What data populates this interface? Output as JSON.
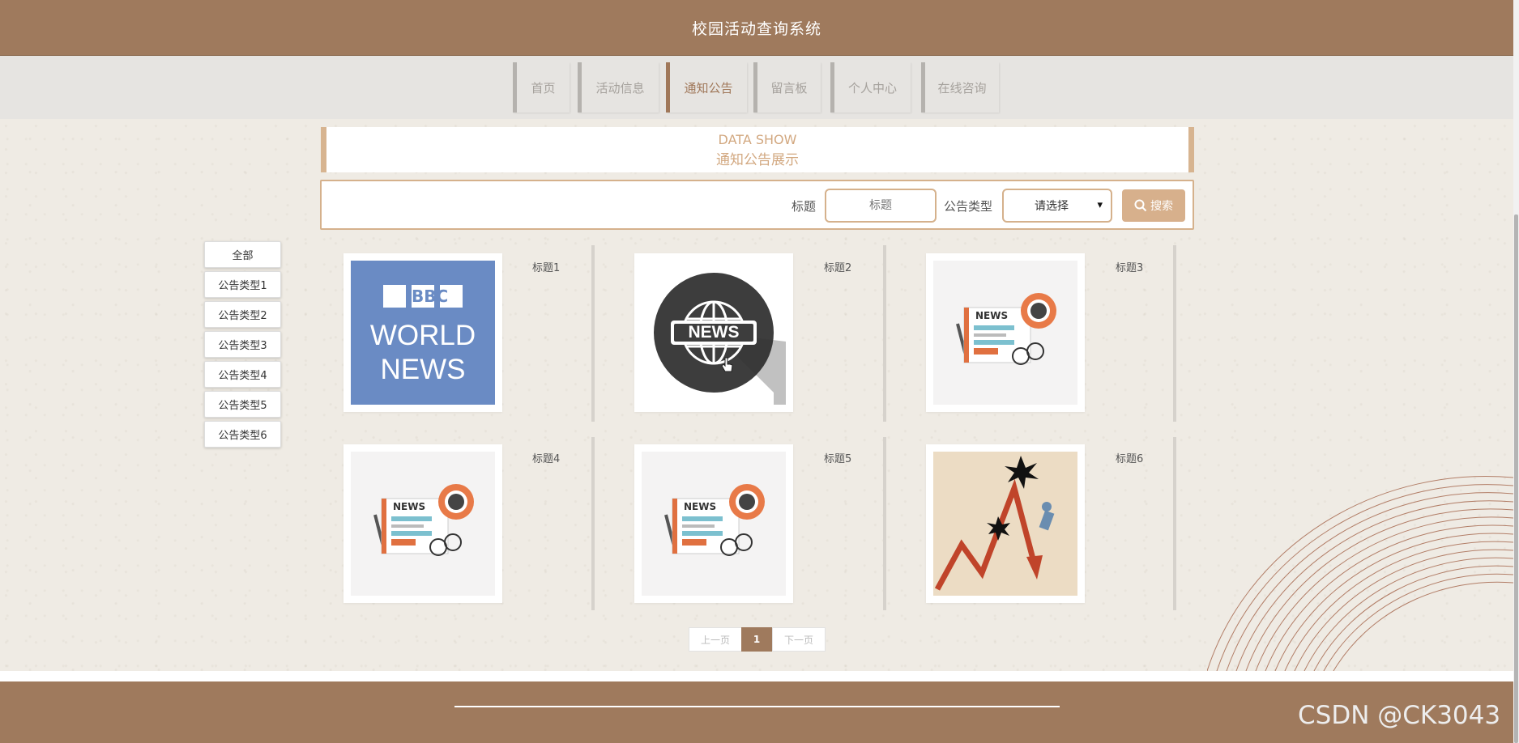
{
  "header": {
    "title": "校园活动查询系统"
  },
  "nav": {
    "items": [
      {
        "label": "首页",
        "active": false
      },
      {
        "label": "活动信息",
        "active": false
      },
      {
        "label": "通知公告",
        "active": true
      },
      {
        "label": "留言板",
        "active": false
      },
      {
        "label": "个人中心",
        "active": false
      },
      {
        "label": "在线咨询",
        "active": false
      }
    ]
  },
  "section": {
    "title_en": "DATA SHOW",
    "title_cn": "通知公告展示"
  },
  "search": {
    "title_label": "标题",
    "title_placeholder": "标题",
    "type_label": "公告类型",
    "type_selected": "请选择",
    "button_label": "搜索"
  },
  "sidebar": {
    "categories": [
      "全部",
      "公告类型1",
      "公告类型2",
      "公告类型3",
      "公告类型4",
      "公告类型5",
      "公告类型6"
    ]
  },
  "cards": [
    {
      "title": "标题1",
      "image": "bbc-world-news"
    },
    {
      "title": "标题2",
      "image": "news-globe-badge"
    },
    {
      "title": "标题3",
      "image": "newspaper-coffee-glasses"
    },
    {
      "title": "标题4",
      "image": "newspaper-coffee-glasses"
    },
    {
      "title": "标题5",
      "image": "newspaper-coffee-glasses"
    },
    {
      "title": "标题6",
      "image": "falling-stock-chart"
    }
  ],
  "bbc_image_text": {
    "line1": "BBC",
    "line2": "WORLD",
    "line3": "NEWS"
  },
  "news_badge_text": "NEWS",
  "pagination": {
    "prev": "上一页",
    "current": "1",
    "next": "下一页"
  },
  "watermark": "CSDN @CK3043",
  "colors": {
    "brand": "#9f7a5d",
    "accent": "#d7b08c"
  }
}
